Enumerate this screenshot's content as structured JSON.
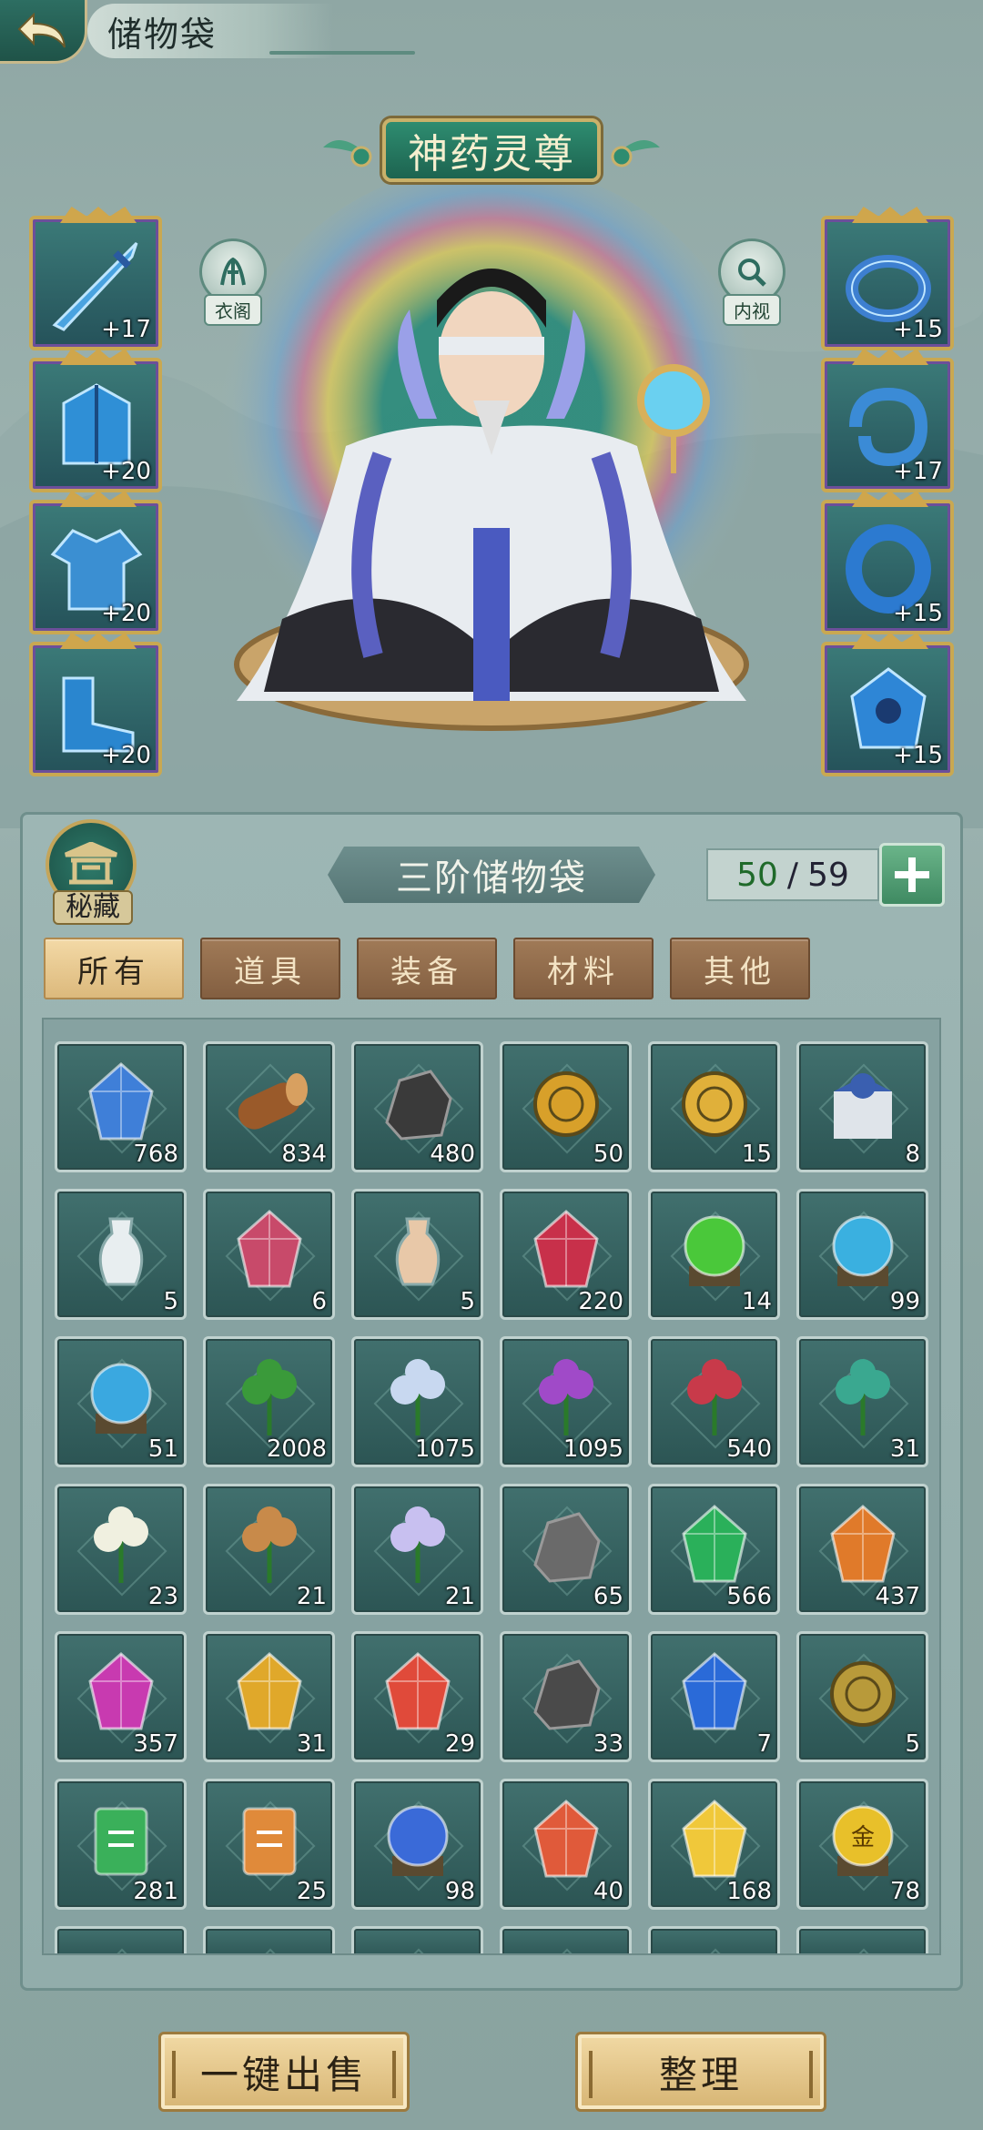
{
  "header": {
    "title": "储物袋"
  },
  "rank": {
    "title": "神药灵尊"
  },
  "stage_buttons": {
    "wardrobe": "衣阁",
    "inspect": "内视"
  },
  "equipment_left": [
    {
      "icon": "sword-icon",
      "level": "+17",
      "color": "#4aa3e0"
    },
    {
      "icon": "armor-icon",
      "level": "+20",
      "color": "#2f8fd6"
    },
    {
      "icon": "robe-icon",
      "level": "+20",
      "color": "#3b8fd2"
    },
    {
      "icon": "boots-icon",
      "level": "+20",
      "color": "#2a86cf"
    }
  ],
  "equipment_right": [
    {
      "icon": "ring-icon",
      "level": "+15",
      "color": "#3d7fd0"
    },
    {
      "icon": "amulet-icon",
      "level": "+17",
      "color": "#3b8bd6"
    },
    {
      "icon": "bracelet-icon",
      "level": "+15",
      "color": "#2c7ad0"
    },
    {
      "icon": "talisman-icon",
      "level": "+15",
      "color": "#2e86d6"
    }
  ],
  "bag": {
    "secret_label": "秘藏",
    "title": "三阶储物袋",
    "capacity_current": "50",
    "capacity_sep": "/",
    "capacity_max": "59"
  },
  "tabs": [
    {
      "label": "所有",
      "active": true
    },
    {
      "label": "道具",
      "active": false
    },
    {
      "label": "装备",
      "active": false
    },
    {
      "label": "材料",
      "active": false
    },
    {
      "label": "其他",
      "active": false
    }
  ],
  "items": [
    {
      "icon": "blue-crystal-icon",
      "count": "768",
      "color": "#3f7fd8"
    },
    {
      "icon": "wood-log-icon",
      "count": "834",
      "color": "#9a5a2a"
    },
    {
      "icon": "black-ore-icon",
      "count": "480",
      "color": "#3a3a3a"
    },
    {
      "icon": "golden-orb-icon",
      "count": "50",
      "color": "#d8a02a"
    },
    {
      "icon": "gold-medallion-icon",
      "count": "15",
      "color": "#e0b03a"
    },
    {
      "icon": "gift-box-icon",
      "count": "8",
      "color": "#3a5fb0"
    },
    {
      "icon": "white-vase-icon",
      "count": "5",
      "color": "#e8eef0"
    },
    {
      "icon": "red-crystal-icon",
      "count": "6",
      "color": "#c84a6a"
    },
    {
      "icon": "gourd-icon",
      "count": "5",
      "color": "#e8c8a8"
    },
    {
      "icon": "ruby-cluster-icon",
      "count": "220",
      "color": "#c8304a"
    },
    {
      "icon": "green-orb-icon",
      "count": "14",
      "color": "#4ac83a"
    },
    {
      "icon": "cyan-orb-icon",
      "count": "99",
      "color": "#3ab0e0"
    },
    {
      "icon": "cyan-orb-icon",
      "count": "51",
      "color": "#3aa8e0"
    },
    {
      "icon": "green-herb-icon",
      "count": "2008",
      "color": "#3a9a3a"
    },
    {
      "icon": "lotus-icon",
      "count": "1075",
      "color": "#c8d8f0"
    },
    {
      "icon": "purple-flower-icon",
      "count": "1095",
      "color": "#a04ac8"
    },
    {
      "icon": "red-mushroom-icon",
      "count": "540",
      "color": "#c83a4a"
    },
    {
      "icon": "spirit-herb-icon",
      "count": "31",
      "color": "#3aa890"
    },
    {
      "icon": "white-flower-icon",
      "count": "23",
      "color": "#f0f0e0"
    },
    {
      "icon": "ginseng-icon",
      "count": "21",
      "color": "#c88a4a"
    },
    {
      "icon": "crystal-lotus-icon",
      "count": "21",
      "color": "#c8c0f0"
    },
    {
      "icon": "grey-stone-icon",
      "count": "65",
      "color": "#6a6a6a"
    },
    {
      "icon": "emerald-icon",
      "count": "566",
      "color": "#2ab05a"
    },
    {
      "icon": "amber-shard-icon",
      "count": "437",
      "color": "#e07a2a"
    },
    {
      "icon": "magenta-gem-icon",
      "count": "357",
      "color": "#c83ab0"
    },
    {
      "icon": "topaz-icon",
      "count": "31",
      "color": "#e0a82a"
    },
    {
      "icon": "fire-crystal-icon",
      "count": "29",
      "color": "#e04a3a"
    },
    {
      "icon": "dark-ore-icon",
      "count": "33",
      "color": "#4a4a4a"
    },
    {
      "icon": "sapphire-icon",
      "count": "7",
      "color": "#2a6ad8"
    },
    {
      "icon": "gold-coin-icon",
      "count": "5",
      "color": "#b89a3a"
    },
    {
      "icon": "green-talisman-icon",
      "count": "281",
      "color": "#3ab05a"
    },
    {
      "icon": "orange-talisman-icon",
      "count": "25",
      "color": "#e08a3a"
    },
    {
      "icon": "blue-swirl-orb-icon",
      "count": "98",
      "color": "#3a6ad8"
    },
    {
      "icon": "prism-crystal-icon",
      "count": "40",
      "color": "#e05a3a"
    },
    {
      "icon": "yellow-crystal-icon",
      "count": "168",
      "color": "#f0c83a"
    },
    {
      "icon": "gold-seal-icon",
      "count": "78",
      "color": "#e8c02a"
    }
  ],
  "gold_seal_char": "金",
  "buttons": {
    "sell_all": "一键出售",
    "sort": "整理"
  }
}
